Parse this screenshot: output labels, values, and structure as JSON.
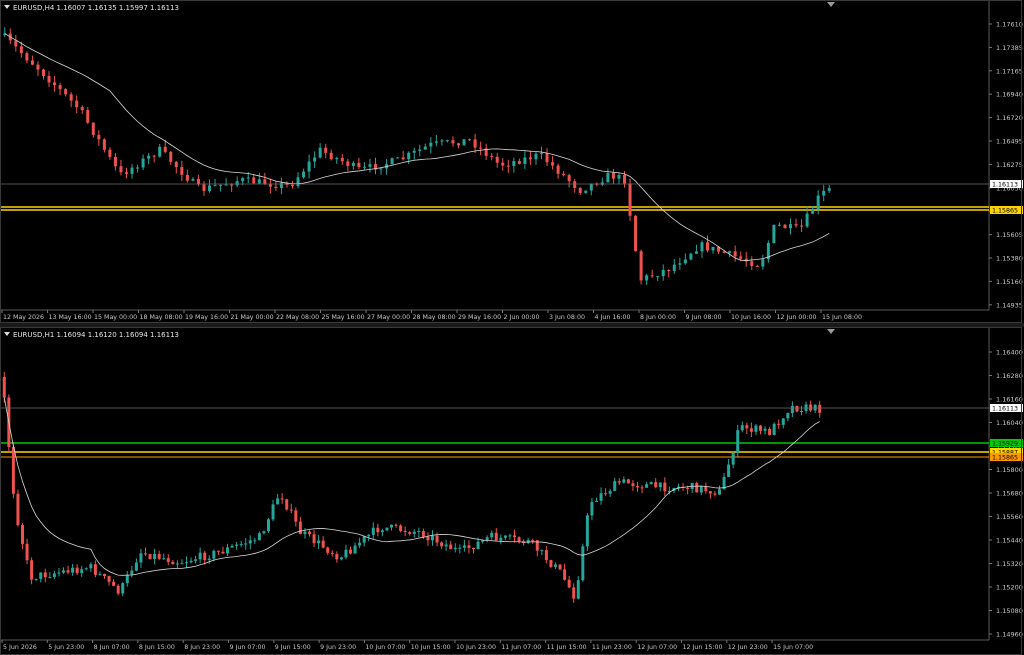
{
  "colors": {
    "background": "#000000",
    "bull": "#26a69a",
    "bear": "#ef5350",
    "ma": "#d9d9d9",
    "yellow": "#ffd500",
    "green": "#00c800",
    "orange": "#ff9900",
    "grid_text": "#c8c8c8",
    "bid_line": "#6e6e6e"
  },
  "top": {
    "title": "EURUSD,H4  1.16007 1.16135 1.15997 1.16113",
    "icon": "chevron-down-icon",
    "price_labels": [
      "1.17610",
      "1.17385",
      "1.17165",
      "1.16940",
      "1.16720",
      "1.16495",
      "1.16275",
      "1.16050",
      "1.15825",
      "1.15605",
      "1.15380",
      "1.15160",
      "1.14935"
    ],
    "bid_label": "1.16113",
    "level_label": "1.15865",
    "time_labels": [
      "12 May 2026",
      "13 May 16:00",
      "15 May 00:00",
      "18 May 08:00",
      "19 May 16:00",
      "21 May 00:00",
      "22 May 08:00",
      "25 May 16:00",
      "27 May 00:00",
      "28 May 08:00",
      "29 May 16:00",
      "2 Jun 00:00",
      "3 Jun 08:00",
      "4 Jun 16:00",
      "8 Jun 00:00",
      "9 Jun 08:00",
      "10 Jun 16:00",
      "12 Jun 00:00",
      "15 Jun 08:00"
    ]
  },
  "bottom": {
    "title": "EURUSD,H1  1.16094 1.16120 1.16094 1.16113",
    "icon": "chevron-down-icon",
    "price_labels": [
      "1.16400",
      "1.16280",
      "1.16160",
      "1.16040",
      "1.15920",
      "1.15800",
      "1.15680",
      "1.15560",
      "1.15440",
      "1.15320",
      "1.15200",
      "1.15080",
      "1.14960"
    ],
    "bid_label": "1.16113",
    "green_label": "1.15929",
    "yellow_label": "1.15887",
    "orange_label": "1.15865",
    "time_labels": [
      "5 Jun 2026",
      "5 Jun 23:00",
      "8 Jun 07:00",
      "8 Jun 15:00",
      "8 Jun 23:00",
      "9 Jun 07:00",
      "9 Jun 15:00",
      "9 Jun 23:00",
      "10 Jun 07:00",
      "10 Jun 15:00",
      "10 Jun 23:00",
      "11 Jun 07:00",
      "11 Jun 15:00",
      "11 Jun 23:00",
      "12 Jun 07:00",
      "12 Jun 15:00",
      "12 Jun 23:00",
      "15 Jun 07:00"
    ]
  }
}
